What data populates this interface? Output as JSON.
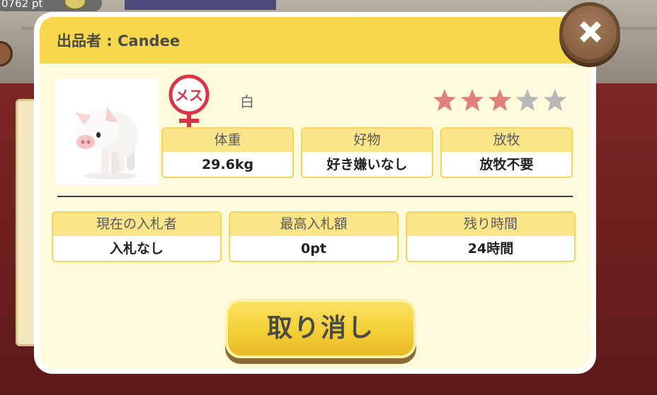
{
  "background": {
    "points_text": "0762 pt"
  },
  "dialog": {
    "seller_label": "出品者 : Candee",
    "gender": "メス",
    "color": "白",
    "rating": 3,
    "rating_max": 5,
    "colors": {
      "header": "#f7d84d",
      "panel": "#fdfbdc",
      "star_filled": "#e0807a",
      "star_empty": "#b8b8b8",
      "gender": "#d8344a"
    },
    "stats": [
      {
        "label": "体重",
        "value": "29.6kg"
      },
      {
        "label": "好物",
        "value": "好き嫌いなし"
      },
      {
        "label": "放牧",
        "value": "放牧不要"
      }
    ],
    "auction": [
      {
        "label": "現在の入札者",
        "value": "入札なし"
      },
      {
        "label": "最高入札額",
        "value": "0pt"
      },
      {
        "label": "残り時間",
        "value": "24時間"
      }
    ],
    "cancel_label": "取り消し"
  }
}
